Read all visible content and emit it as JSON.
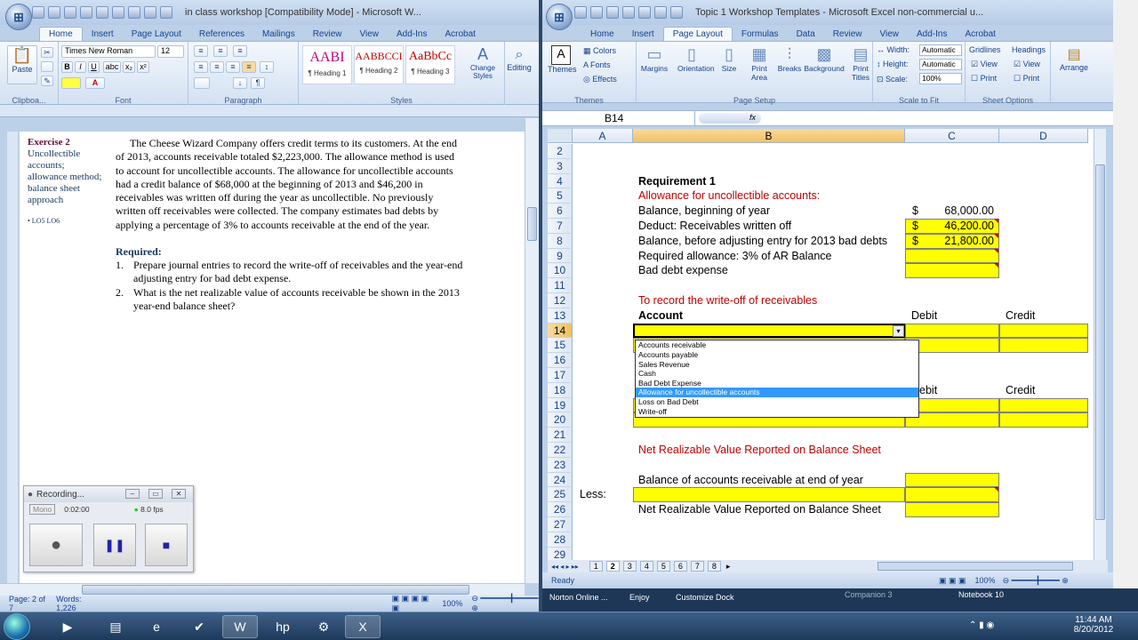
{
  "word": {
    "title": "in class workshop [Compatibility Mode] - Microsoft W...",
    "tabs": [
      "Home",
      "Insert",
      "Page Layout",
      "References",
      "Mailings",
      "Review",
      "View",
      "Add-Ins",
      "Acrobat"
    ],
    "font_name": "Times New Roman",
    "font_size": "12",
    "styles": [
      {
        "preview": "AABI",
        "label": "¶ Heading 1"
      },
      {
        "preview": "AABBCCI",
        "label": "¶ Heading 2"
      },
      {
        "preview": "AaBbCc",
        "label": "¶ Heading 3"
      }
    ],
    "change_styles": "Change Styles",
    "editing": "Editing",
    "groups": {
      "clipboard": "Clipboa...",
      "font": "Font",
      "paragraph": "Paragraph",
      "styles": "Styles"
    },
    "paste": "Paste",
    "sidebar": {
      "heading": "Exercise 2",
      "topic": [
        "Uncollectible",
        "accounts;",
        "allowance method;",
        "balance sheet",
        "approach"
      ],
      "lo": "• LO5 LO6"
    },
    "body_lines": [
      "The Cheese Wizard Company offers credit terms to its customers.  At the end",
      "of 2013, accounts receivable totaled $2,223,000.  The allowance method is used",
      "to account for uncollectible accounts.  The allowance for uncollectible accounts",
      "had a credit balance of $68,000 at the beginning of 2013 and $46,200 in",
      "receivables was written off during the year as uncollectible.  No previously",
      "written off receivables were collected.  The company estimates bad debts by",
      "applying a percentage of 3% to accounts receivable at the end of the year."
    ],
    "required_label": "Required:",
    "required_items": [
      {
        "num": "1.",
        "lines": [
          "Prepare journal entries to record the write-off of receivables and the year-end",
          "adjusting entry for bad debt expense."
        ]
      },
      {
        "num": "2.",
        "lines": [
          "What is the net realizable value of accounts receivable be shown in the 2013",
          "year-end balance sheet?"
        ]
      }
    ],
    "status": {
      "page": "Page: 2 of 7",
      "words": "Words: 1,226",
      "zoom": "100%"
    }
  },
  "recording": {
    "title": "Recording...",
    "mode": "Mono",
    "time": "0:02:00",
    "fps": "8.0 fps"
  },
  "excel": {
    "title": "Topic 1 Workshop Templates - Microsoft Excel non-commercial u...",
    "tabs": [
      "Home",
      "Insert",
      "Page Layout",
      "Formulas",
      "Data",
      "Review",
      "View",
      "Add-Ins",
      "Acrobat"
    ],
    "ribbon": {
      "themes": "Themes",
      "colors": "Colors",
      "fonts": "Fonts",
      "effects": "Effects",
      "margins": "Margins",
      "orientation": "Orientation",
      "size": "Size",
      "print_area": "Print Area",
      "breaks": "Breaks",
      "background": "Background",
      "print_titles": "Print Titles",
      "width_label": "Width:",
      "width_val": "Automatic",
      "height_label": "Height:",
      "height_val": "Automatic",
      "scale_label": "Scale:",
      "scale_val": "100%",
      "gridlines": "Gridlines",
      "headings": "Headings",
      "view": "View",
      "print": "Print",
      "arrange": "Arrange",
      "grp_themes": "Themes",
      "grp_page_setup": "Page Setup",
      "grp_scale": "Scale to Fit",
      "grp_sheet": "Sheet Options"
    },
    "namebox": "B14",
    "fx": "fx",
    "columns": [
      "A",
      "B",
      "C",
      "D"
    ],
    "rows": [
      "2",
      "3",
      "4",
      "5",
      "6",
      "7",
      "8",
      "9",
      "10",
      "11",
      "12",
      "13",
      "14",
      "15",
      "16",
      "17",
      "18",
      "19",
      "20",
      "21",
      "22",
      "23",
      "24",
      "25",
      "26",
      "27",
      "28",
      "29"
    ],
    "req1": "Requirement 1",
    "allowance_title": "Allowance for uncollectible accounts:",
    "bal_begin": "Balance, beginning of year",
    "bal_begin_val": "68,000.00",
    "deduct": "Deduct: Receivables written off",
    "deduct_val": "46,200.00",
    "bal_before": "Balance, before adjusting entry for 2013 bad debts",
    "bal_before_val": "21,800.00",
    "dollar": "$",
    "required_allow": "Required allowance: 3% of AR Balance",
    "bad_debt": "Bad debt expense",
    "writeoff_title": "To record the write-off of receivables",
    "account": "Account",
    "debit": "Debit",
    "credit": "Credit",
    "dropdown": [
      "Accounts receivable",
      "Accounts payable",
      "Sales Revenue",
      "Cash",
      "Bad Debt Expense",
      "Allowance for uncollectible accounts",
      "Loss on Bad Debt",
      "Write-off"
    ],
    "dropdown_selected": 5,
    "nrv_title": "Net Realizable Value Reported on Balance Sheet",
    "bal_ar_end": "Balance of accounts receivable at end of year",
    "less": "Less:",
    "nrv_label": "Net Realizable Value Reported on Balance Sheet",
    "sheets": [
      "1",
      "2",
      "3",
      "4",
      "5",
      "6",
      "7",
      "8"
    ],
    "status_ready": "Ready",
    "zoom": "100%"
  },
  "dock": {
    "items": [
      "Norton Online ...",
      "Enjoy",
      "Customize Dock",
      "Companion 3",
      "Notebook 10"
    ]
  },
  "taskbar": {
    "time": "11:44 AM",
    "date": "8/20/2012"
  }
}
